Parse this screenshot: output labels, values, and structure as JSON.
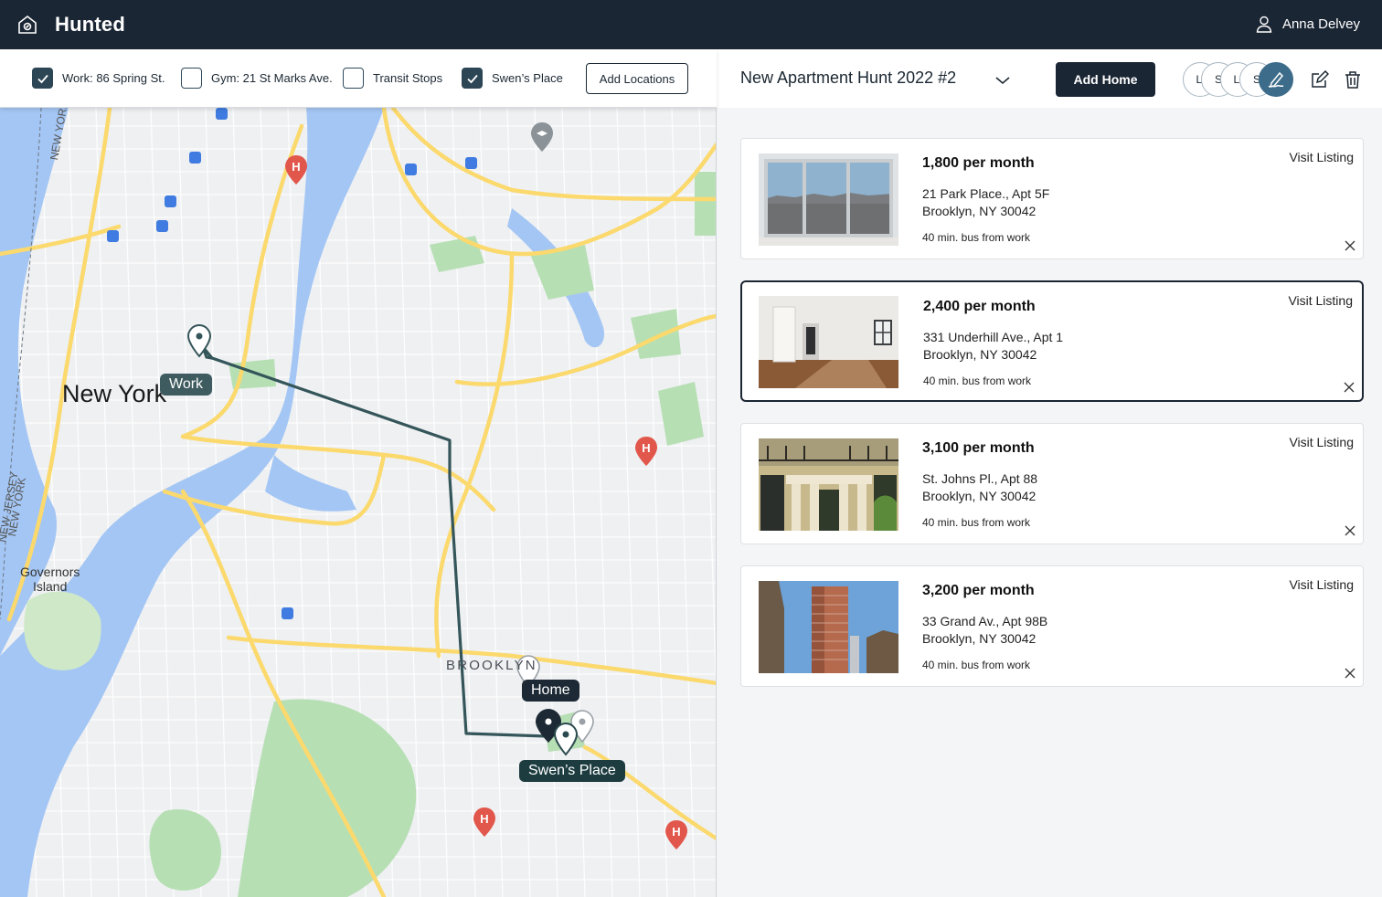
{
  "app": {
    "title": "Hunted",
    "user_name": "Anna Delvey"
  },
  "filters": [
    {
      "label": "Work: 86 Spring St.",
      "checked": true
    },
    {
      "label": "Gym: 21 St Marks Ave.",
      "checked": false
    },
    {
      "label": "Transit Stops",
      "checked": false
    },
    {
      "label": "Swen’s Place",
      "checked": true
    }
  ],
  "add_locations_label": "Add Locations",
  "map": {
    "labels": {
      "new_york": "New York",
      "brooklyn": "BROOKLYN",
      "governors_island": "Governors\nIsland",
      "new_jersey": "NEW JERSEY",
      "new_york_vertical": "NEW YORK",
      "nj_top": "NEW YORK"
    },
    "pins": {
      "work": "Work",
      "home": "Home",
      "swens_place": "Swen’s Place"
    },
    "colors": {
      "water": "#a4c6f4",
      "park": "#b7dfb4",
      "road": "#fbd96d",
      "route": "#345559"
    }
  },
  "panel": {
    "hunt_title": "New Apartment Hunt 2022 #2",
    "add_home_label": "Add Home",
    "collaborators": [
      "L'",
      "S",
      "L'",
      "S"
    ]
  },
  "listings": [
    {
      "price": "1,800 per month",
      "address_line1": "21 Park Place., Apt 5F",
      "address_line2": "Brooklyn, NY 30042",
      "commute": "40 min. bus from work",
      "visit_label": "Visit Listing",
      "selected": false
    },
    {
      "price": "2,400 per month",
      "address_line1": "331 Underhill Ave., Apt 1",
      "address_line2": "Brooklyn, NY 30042",
      "commute": "40 min. bus from work",
      "visit_label": "Visit Listing",
      "selected": true
    },
    {
      "price": "3,100 per month",
      "address_line1": "St. Johns Pl., Apt 88",
      "address_line2": "Brooklyn, NY 30042",
      "commute": "40 min. bus from work",
      "visit_label": "Visit Listing",
      "selected": false
    },
    {
      "price": "3,200 per month",
      "address_line1": "33 Grand Av., Apt 98B",
      "address_line2": "Brooklyn, NY 30042",
      "commute": "40 min. bus from work",
      "visit_label": "Visit Listing",
      "selected": false
    }
  ]
}
